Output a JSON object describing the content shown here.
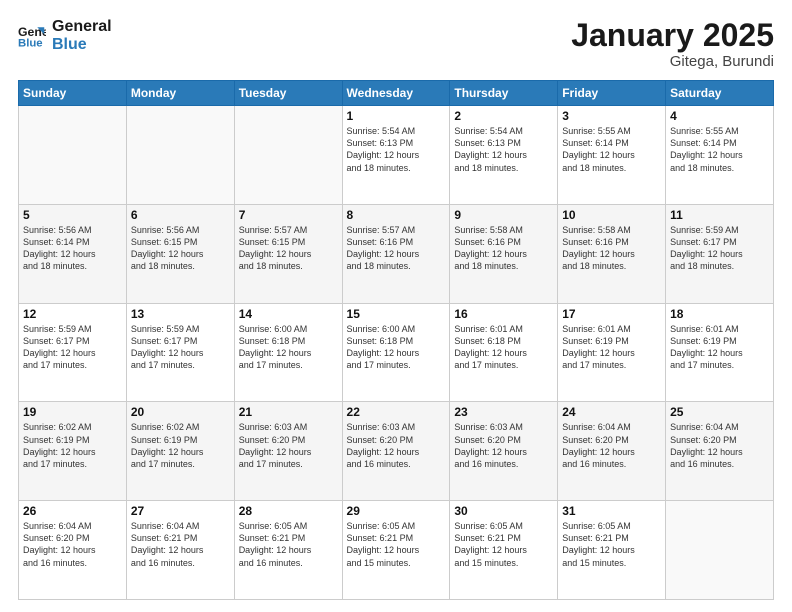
{
  "header": {
    "logo_line1": "General",
    "logo_line2": "Blue",
    "month_title": "January 2025",
    "location": "Gitega, Burundi"
  },
  "weekdays": [
    "Sunday",
    "Monday",
    "Tuesday",
    "Wednesday",
    "Thursday",
    "Friday",
    "Saturday"
  ],
  "weeks": [
    [
      {
        "day": "",
        "info": ""
      },
      {
        "day": "",
        "info": ""
      },
      {
        "day": "",
        "info": ""
      },
      {
        "day": "1",
        "info": "Sunrise: 5:54 AM\nSunset: 6:13 PM\nDaylight: 12 hours\nand 18 minutes."
      },
      {
        "day": "2",
        "info": "Sunrise: 5:54 AM\nSunset: 6:13 PM\nDaylight: 12 hours\nand 18 minutes."
      },
      {
        "day": "3",
        "info": "Sunrise: 5:55 AM\nSunset: 6:14 PM\nDaylight: 12 hours\nand 18 minutes."
      },
      {
        "day": "4",
        "info": "Sunrise: 5:55 AM\nSunset: 6:14 PM\nDaylight: 12 hours\nand 18 minutes."
      }
    ],
    [
      {
        "day": "5",
        "info": "Sunrise: 5:56 AM\nSunset: 6:14 PM\nDaylight: 12 hours\nand 18 minutes."
      },
      {
        "day": "6",
        "info": "Sunrise: 5:56 AM\nSunset: 6:15 PM\nDaylight: 12 hours\nand 18 minutes."
      },
      {
        "day": "7",
        "info": "Sunrise: 5:57 AM\nSunset: 6:15 PM\nDaylight: 12 hours\nand 18 minutes."
      },
      {
        "day": "8",
        "info": "Sunrise: 5:57 AM\nSunset: 6:16 PM\nDaylight: 12 hours\nand 18 minutes."
      },
      {
        "day": "9",
        "info": "Sunrise: 5:58 AM\nSunset: 6:16 PM\nDaylight: 12 hours\nand 18 minutes."
      },
      {
        "day": "10",
        "info": "Sunrise: 5:58 AM\nSunset: 6:16 PM\nDaylight: 12 hours\nand 18 minutes."
      },
      {
        "day": "11",
        "info": "Sunrise: 5:59 AM\nSunset: 6:17 PM\nDaylight: 12 hours\nand 18 minutes."
      }
    ],
    [
      {
        "day": "12",
        "info": "Sunrise: 5:59 AM\nSunset: 6:17 PM\nDaylight: 12 hours\nand 17 minutes."
      },
      {
        "day": "13",
        "info": "Sunrise: 5:59 AM\nSunset: 6:17 PM\nDaylight: 12 hours\nand 17 minutes."
      },
      {
        "day": "14",
        "info": "Sunrise: 6:00 AM\nSunset: 6:18 PM\nDaylight: 12 hours\nand 17 minutes."
      },
      {
        "day": "15",
        "info": "Sunrise: 6:00 AM\nSunset: 6:18 PM\nDaylight: 12 hours\nand 17 minutes."
      },
      {
        "day": "16",
        "info": "Sunrise: 6:01 AM\nSunset: 6:18 PM\nDaylight: 12 hours\nand 17 minutes."
      },
      {
        "day": "17",
        "info": "Sunrise: 6:01 AM\nSunset: 6:19 PM\nDaylight: 12 hours\nand 17 minutes."
      },
      {
        "day": "18",
        "info": "Sunrise: 6:01 AM\nSunset: 6:19 PM\nDaylight: 12 hours\nand 17 minutes."
      }
    ],
    [
      {
        "day": "19",
        "info": "Sunrise: 6:02 AM\nSunset: 6:19 PM\nDaylight: 12 hours\nand 17 minutes."
      },
      {
        "day": "20",
        "info": "Sunrise: 6:02 AM\nSunset: 6:19 PM\nDaylight: 12 hours\nand 17 minutes."
      },
      {
        "day": "21",
        "info": "Sunrise: 6:03 AM\nSunset: 6:20 PM\nDaylight: 12 hours\nand 17 minutes."
      },
      {
        "day": "22",
        "info": "Sunrise: 6:03 AM\nSunset: 6:20 PM\nDaylight: 12 hours\nand 16 minutes."
      },
      {
        "day": "23",
        "info": "Sunrise: 6:03 AM\nSunset: 6:20 PM\nDaylight: 12 hours\nand 16 minutes."
      },
      {
        "day": "24",
        "info": "Sunrise: 6:04 AM\nSunset: 6:20 PM\nDaylight: 12 hours\nand 16 minutes."
      },
      {
        "day": "25",
        "info": "Sunrise: 6:04 AM\nSunset: 6:20 PM\nDaylight: 12 hours\nand 16 minutes."
      }
    ],
    [
      {
        "day": "26",
        "info": "Sunrise: 6:04 AM\nSunset: 6:20 PM\nDaylight: 12 hours\nand 16 minutes."
      },
      {
        "day": "27",
        "info": "Sunrise: 6:04 AM\nSunset: 6:21 PM\nDaylight: 12 hours\nand 16 minutes."
      },
      {
        "day": "28",
        "info": "Sunrise: 6:05 AM\nSunset: 6:21 PM\nDaylight: 12 hours\nand 16 minutes."
      },
      {
        "day": "29",
        "info": "Sunrise: 6:05 AM\nSunset: 6:21 PM\nDaylight: 12 hours\nand 15 minutes."
      },
      {
        "day": "30",
        "info": "Sunrise: 6:05 AM\nSunset: 6:21 PM\nDaylight: 12 hours\nand 15 minutes."
      },
      {
        "day": "31",
        "info": "Sunrise: 6:05 AM\nSunset: 6:21 PM\nDaylight: 12 hours\nand 15 minutes."
      },
      {
        "day": "",
        "info": ""
      }
    ]
  ]
}
